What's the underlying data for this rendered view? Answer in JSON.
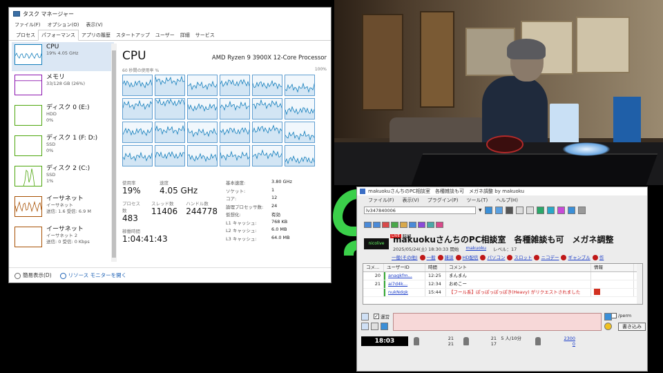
{
  "task_manager": {
    "title": "タスク マネージャー",
    "menu": [
      "ファイル(F)",
      "オプション(O)",
      "表示(V)"
    ],
    "tabs": [
      "プロセス",
      "パフォーマンス",
      "アプリの履歴",
      "スタートアップ",
      "ユーザー",
      "詳細",
      "サービス"
    ],
    "active_tab": "パフォーマンス",
    "side_items": [
      {
        "name": "CPU",
        "s1": "19%  4.05 GHz",
        "s2": "",
        "color": "#117dbb"
      },
      {
        "name": "メモリ",
        "s1": "33/128 GB (26%)",
        "s2": "",
        "color": "#8b12ae"
      },
      {
        "name": "ディスク 0 (E:)",
        "s1": "HDD",
        "s2": "0%",
        "color": "#4da60c"
      },
      {
        "name": "ディスク 1 (F: D:)",
        "s1": "SSD",
        "s2": "0%",
        "color": "#4da60c"
      },
      {
        "name": "ディスク 2 (C:)",
        "s1": "SSD",
        "s2": "1%",
        "color": "#4da60c"
      },
      {
        "name": "イーサネット",
        "s1": "イーサネット",
        "s2": "送信: 1.6 受信: 6.9 M",
        "color": "#a74f01"
      },
      {
        "name": "イーサネット",
        "s1": "イーサネット 2",
        "s2": "送信: 0 受信: 0 Kbps",
        "color": "#a74f01"
      }
    ],
    "main": {
      "title": "CPU",
      "processor": "AMD Ryzen 9 3900X 12-Core Processor",
      "util_label": "60 秒間の使用率 %",
      "util_max": "100%",
      "core_usage": [
        22,
        30,
        18,
        25,
        20,
        12,
        28,
        35,
        22,
        26,
        30,
        14,
        20,
        24,
        18,
        22,
        26,
        10,
        16,
        20,
        14,
        18,
        22,
        8
      ],
      "stats": {
        "usage_label": "使用率",
        "usage": "19%",
        "speed_label": "速度",
        "speed": "4.05 GHz",
        "process_label": "プロセス数",
        "process": "483",
        "thread_label": "スレッド数",
        "thread": "11406",
        "handle_label": "ハンドル数",
        "handle": "244778",
        "uptime_label": "稼働時間",
        "uptime": "1:04:41:43"
      },
      "specs": [
        {
          "k": "基本速度:",
          "v": "3.80 GHz"
        },
        {
          "k": "ソケット:",
          "v": "1"
        },
        {
          "k": "コア:",
          "v": "12"
        },
        {
          "k": "論理プロセッサ数:",
          "v": "24"
        },
        {
          "k": "仮想化:",
          "v": "有効"
        },
        {
          "k": "L1 キャッシュ:",
          "v": "768 KB"
        },
        {
          "k": "L2 キャッシュ:",
          "v": "6.0 MB"
        },
        {
          "k": "L3 キャッシュ:",
          "v": "64.0 MB"
        }
      ]
    },
    "footer": {
      "simple": "簡易表示(D)",
      "monitor": "リソース モニターを開く"
    }
  },
  "comment_viewer": {
    "title": "makuokuさんちのPC相談室　各種雑談も可　メガネ調整 by makuoku",
    "menu": [
      "ファイル(F)",
      "表示(V)",
      "プラグイン(P)",
      "ツール(T)",
      "ヘルプ(H)"
    ],
    "url": "lv347840006",
    "live_logo": "nicolive",
    "badges": [
      "LIVE",
      "HD"
    ],
    "stream_title": "makuokuさんちのPC相談室　各種雑談も可　メガネ調整",
    "date": "2025/05/24(土) 18:30:33 開始",
    "owner": "makuoku",
    "level": "レベル：17",
    "tags": [
      "一般(その他)",
      "一般",
      "雑談",
      "HD配信",
      "パソコン",
      "スロット",
      "ニコデー",
      "ギャンブル",
      "作"
    ],
    "columns": [
      "コメ...",
      "ユーザーID",
      "時間",
      "コメント",
      "情報"
    ],
    "rows": [
      {
        "no": "20",
        "user": "anagkfm...",
        "time": "12:25",
        "comment": "まんまん",
        "highlight": false,
        "flag": false
      },
      {
        "no": "21",
        "user": "ai7d4k...",
        "time": "12:34",
        "comment": "おめこー",
        "highlight": false,
        "flag": false
      },
      {
        "no": "",
        "user": "nukNdgk",
        "time": "15:44",
        "comment": "【フール系】ぽっぽっぽっぽき(Heavy) がリクエストされました",
        "highlight": true,
        "flag": true
      }
    ],
    "checkbox_label": "運営",
    "perm_label": "/perm",
    "send_label": "書き込み",
    "clock": "18:03",
    "status": {
      "a1": "21",
      "a2": "21",
      "b1": "21",
      "b2": "17",
      "c1": "5 人/10分",
      "d1": "2300",
      "d2": "0"
    }
  }
}
